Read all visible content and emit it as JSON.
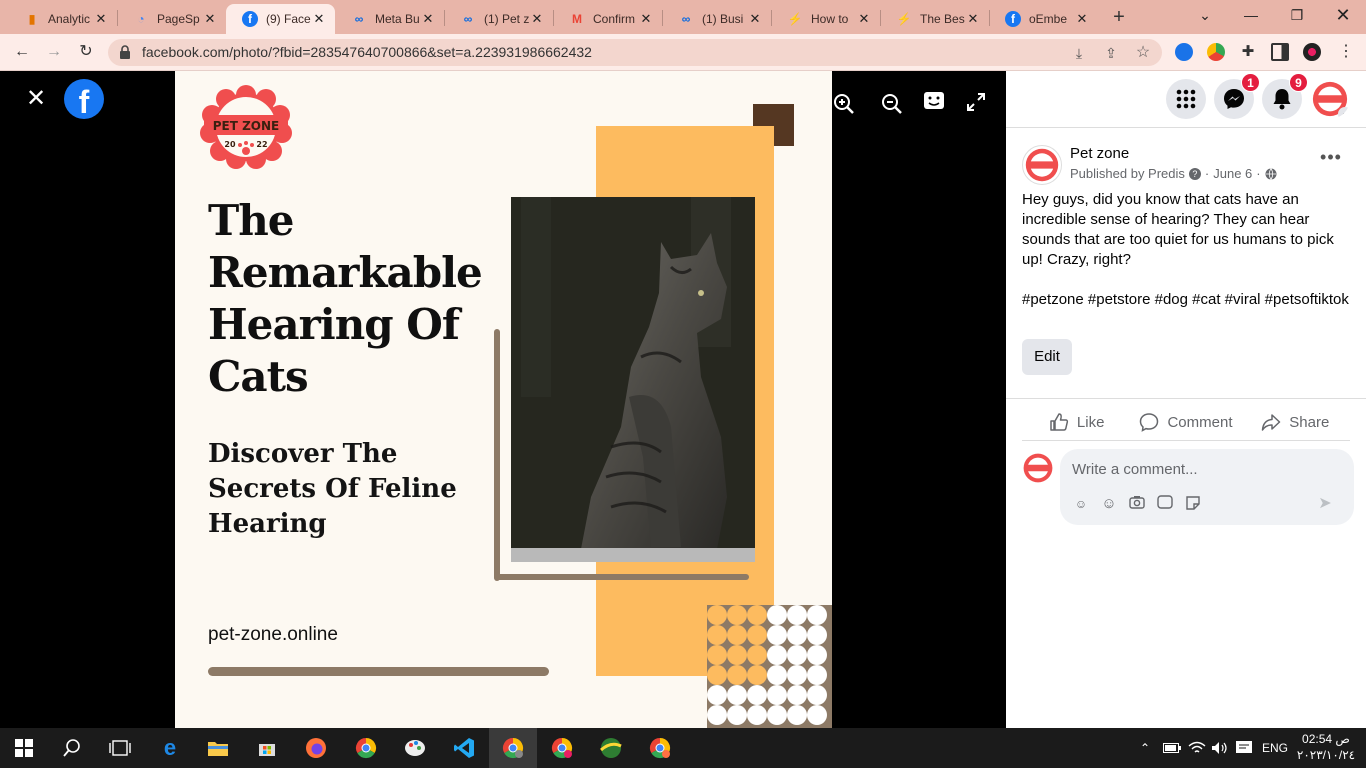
{
  "browser": {
    "tabs": [
      {
        "title": "Analytic",
        "favicon": "analytics-icon",
        "color": "#e37400"
      },
      {
        "title": "PageSp",
        "favicon": "pagespeed-icon",
        "color": "#4285f4"
      },
      {
        "title": "(9) Face",
        "favicon": "facebook-icon",
        "color": "#1877f2",
        "active": true
      },
      {
        "title": "Meta Bu",
        "favicon": "meta-icon",
        "color": "#0668e1"
      },
      {
        "title": "(1) Pet z",
        "favicon": "meta-icon",
        "color": "#0668e1"
      },
      {
        "title": "Confirm",
        "favicon": "gmail-icon",
        "color": "#ea4335"
      },
      {
        "title": "(1) Busi",
        "favicon": "meta-icon",
        "color": "#0668e1"
      },
      {
        "title": "How to",
        "favicon": "bolt-icon",
        "color": "#222222"
      },
      {
        "title": "The Bes",
        "favicon": "bolt-icon",
        "color": "#222222"
      },
      {
        "title": "oEmbe",
        "favicon": "facebook-icon",
        "color": "#1877f2"
      }
    ],
    "url": "facebook.com/photo/?fbid=283547640700866&set=a.223931986662432"
  },
  "poster": {
    "logo_text": "PET ZONE",
    "logo_year_left": "20",
    "logo_year_right": "22",
    "title_lines": [
      "The",
      "Remarkable",
      "Hearing Of",
      "Cats"
    ],
    "subtitle_lines": [
      "Discover The",
      "Secrets Of Feline",
      "Hearing"
    ],
    "website": "pet-zone.online",
    "colors": {
      "accent": "#fdbb5f",
      "brown": "#553722",
      "frame": "#8d7a66",
      "background": "#fdf9f2"
    }
  },
  "post": {
    "page_name": "Pet zone",
    "published_by": "Published by Predis",
    "date": "June 6",
    "text": "Hey guys, did you know that cats have an incredible sense of hearing? They can hear sounds that are too quiet for us humans to pick up! Crazy, right?",
    "hashtags": "#petzone #petstore #dog #cat #viral #petsoftiktok",
    "edit_label": "Edit",
    "like_label": "Like",
    "comment_label": "Comment",
    "share_label": "Share",
    "comment_placeholder": "Write a comment..."
  },
  "topnav": {
    "messenger_badge": "1",
    "notifications_badge": "9"
  },
  "taskbar": {
    "language": "ENG",
    "time": "02:54 ص",
    "date": "٢٠٢٣/١٠/٢٤"
  }
}
